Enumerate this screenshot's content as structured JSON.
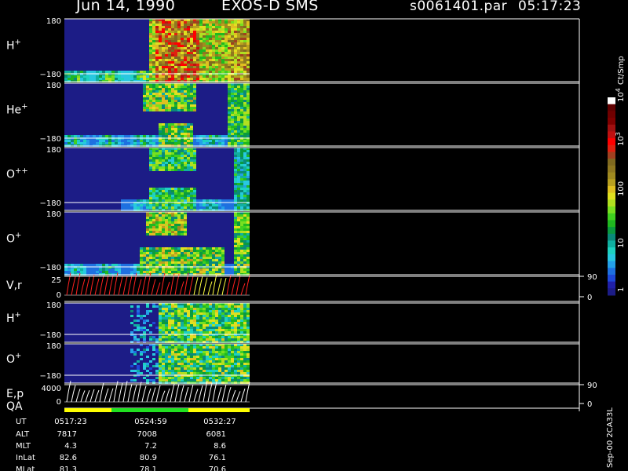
{
  "header": {
    "date": "Jun 14, 1990",
    "instrument": "EXOS-D SMS",
    "file": "s0061401.par",
    "time": "05:17:23"
  },
  "colorbar": {
    "unit": "Ct/Smp",
    "tick_labels": [
      "1",
      "10",
      "100",
      "10",
      "10"
    ],
    "tick_exponents": [
      "",
      "",
      "",
      "3",
      "4"
    ],
    "colors": [
      "#1c1c86",
      "#2020a8",
      "#1e48d8",
      "#1e70e0",
      "#24a0e8",
      "#28c8e0",
      "#1ed2c0",
      "#10b0a0",
      "#0a8a7a",
      "#0a9a40",
      "#20b820",
      "#40d020",
      "#78e020",
      "#b0e020",
      "#e0e020",
      "#e0c020",
      "#b8a020",
      "#a08a20",
      "#907820",
      "#806a20",
      "#a04020",
      "#e02010",
      "#ff0000",
      "#c01010",
      "#a01010",
      "#800000",
      "#700000",
      "#600000",
      "#ffffff"
    ]
  },
  "footer": {
    "row_labels": [
      "UT",
      "ALT",
      "MLT",
      "InLat",
      "MLat"
    ],
    "columns": [
      [
        "0517:23",
        "7817",
        "4.3",
        "82.6",
        "81.3"
      ],
      [
        "0524:59",
        "7008",
        "7.2",
        "80.9",
        "78.1"
      ],
      [
        "0532:27",
        "6081",
        "8.6",
        "76.1",
        "70.6"
      ]
    ],
    "stamp": "Sep-00 2CA33L"
  },
  "chart_data": [
    {
      "type": "heatmap",
      "panel": "H+ (pitch angle)",
      "label": "H",
      "label_sup": "+",
      "ylim": [
        -180,
        180
      ],
      "tick_top": "180",
      "tick_bottom": "−180",
      "data_end_ut": "0532:27",
      "max_counts_approx": 3000
    },
    {
      "type": "heatmap",
      "panel": "He+ (pitch angle)",
      "label": "He",
      "label_sup": "+",
      "ylim": [
        -180,
        180
      ],
      "tick_top": "180",
      "tick_bottom": "−180",
      "max_counts_approx": 300
    },
    {
      "type": "heatmap",
      "panel": "O++ (pitch angle)",
      "label": "O",
      "label_sup": "++",
      "ylim": [
        -180,
        180
      ],
      "tick_top": "180",
      "tick_bottom": "−180",
      "max_counts_approx": 100
    },
    {
      "type": "heatmap",
      "panel": "O+ (pitch angle)",
      "label": "O",
      "label_sup": "+",
      "ylim": [
        -180,
        180
      ],
      "tick_top": "180",
      "tick_bottom": "−180",
      "max_counts_approx": 300
    },
    {
      "type": "line",
      "panel": "V,r",
      "label": "V,r",
      "tick_top": "25",
      "tick_zero": "0",
      "right_ticks": [
        "90",
        "0"
      ],
      "series_colors": [
        "#ff2020",
        "#ffff40",
        "#ffffff"
      ]
    },
    {
      "type": "heatmap",
      "panel": "H+ (second)",
      "label": "H",
      "label_sup": "+",
      "ylim": [
        -180,
        180
      ],
      "tick_top": "180",
      "tick_bottom": "−180"
    },
    {
      "type": "heatmap",
      "panel": "O+ (second)",
      "label": "O",
      "label_sup": "+",
      "ylim": [
        -180,
        180
      ],
      "tick_top": "180",
      "tick_bottom": "−180"
    },
    {
      "type": "line",
      "panel": "E,p",
      "label": "E,p",
      "tick_top": "4000",
      "tick_zero": "0",
      "right_ticks": [
        "90",
        "0"
      ],
      "series_colors": [
        "#ffffff"
      ]
    },
    {
      "type": "bar",
      "panel": "QA",
      "label": "QA",
      "segments": [
        {
          "from_ut": "0517:23",
          "to_ut": "0524:59",
          "color": "#ffff00"
        },
        {
          "from_ut": "0524:59",
          "to_ut": "0532:27",
          "color": "#20e020"
        },
        {
          "from_ut": "0532:27",
          "to_ut": "0540:00",
          "color": "#ffff00"
        }
      ]
    }
  ]
}
